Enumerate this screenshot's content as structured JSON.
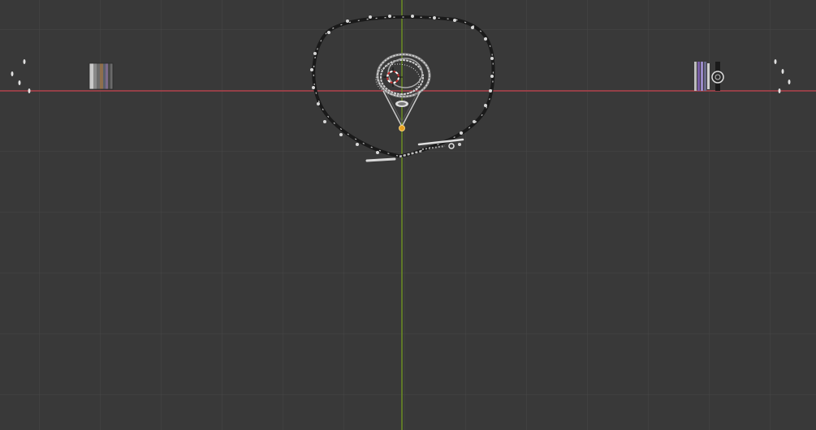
{
  "viewport": {
    "view": "top-orthographic",
    "background_color": "#393939",
    "grid_color": "#474747",
    "axis_x_color": "#b0404a",
    "axis_y_color": "#6b8e23",
    "cursor_color": "#c23030",
    "outline_color": "#e8a020"
  },
  "objects": [
    {
      "name": "necklace-chain",
      "kind": "chain"
    },
    {
      "name": "ring-cluster",
      "kind": "rings"
    },
    {
      "name": "pendant",
      "kind": "pendant"
    },
    {
      "name": "bracelet-pieces",
      "kind": "chain-segments"
    },
    {
      "name": "swatch-bars-left",
      "kind": "color-bars"
    },
    {
      "name": "watch-and-bangles-right",
      "kind": "watch"
    },
    {
      "name": "droplets-left",
      "kind": "drops"
    },
    {
      "name": "droplets-right",
      "kind": "drops"
    }
  ],
  "icons": [
    "3d-cursor-icon"
  ]
}
